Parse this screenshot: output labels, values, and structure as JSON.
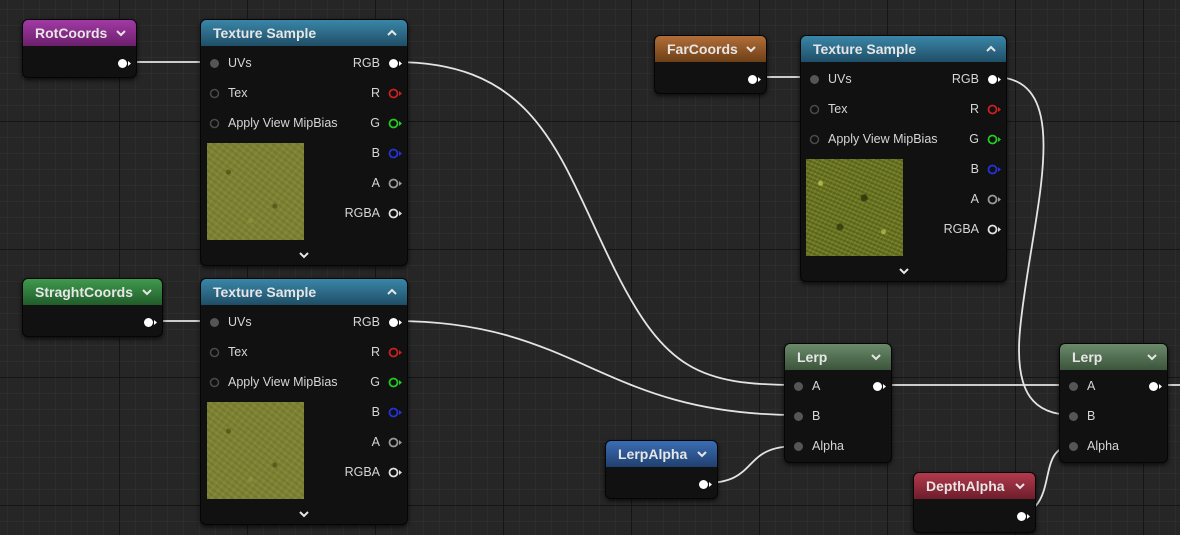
{
  "colors": {
    "background": "#262626",
    "wire": "#e4e4e4",
    "texture_header": "#3a86a8",
    "lerp_header": "#6a8a6a",
    "param_purple": "#a23aa4",
    "param_orange": "#b26e38",
    "param_green": "#3f9a4d",
    "param_blue": "#3b6db4",
    "param_red": "#b23a4e",
    "pin_r": "#cc1f1f",
    "pin_g": "#1fcc1f",
    "pin_b": "#2233dd"
  },
  "icons": {
    "collapse": "chevron-down-icon",
    "expand_node": "chevron-up-icon",
    "more_pins": "chevron-down-icon",
    "pin_connected": "filled-circle-pin-icon",
    "pin_unconnected": "hollow-circle-pin-icon"
  },
  "nodes": {
    "rot_coords": {
      "title": "RotCoords"
    },
    "straight_coords": {
      "title": "StraghtCoords"
    },
    "far_coords": {
      "title": "FarCoords"
    },
    "lerp_alpha": {
      "title": "LerpAlpha"
    },
    "depth_alpha": {
      "title": "DepthAlpha"
    },
    "texture_sample_1": {
      "title": "Texture Sample",
      "inputs": [
        "UVs",
        "Tex",
        "Apply View MipBias"
      ],
      "outputs": [
        "RGB",
        "R",
        "G",
        "B",
        "A",
        "RGBA"
      ]
    },
    "texture_sample_2": {
      "title": "Texture Sample",
      "inputs": [
        "UVs",
        "Tex",
        "Apply View MipBias"
      ],
      "outputs": [
        "RGB",
        "R",
        "G",
        "B",
        "A",
        "RGBA"
      ]
    },
    "texture_sample_3": {
      "title": "Texture Sample",
      "inputs": [
        "UVs",
        "Tex",
        "Apply View MipBias"
      ],
      "outputs": [
        "RGB",
        "R",
        "G",
        "B",
        "A",
        "RGBA"
      ]
    },
    "lerp_1": {
      "title": "Lerp",
      "inputs": [
        "A",
        "B",
        "Alpha"
      ]
    },
    "lerp_2": {
      "title": "Lerp",
      "inputs": [
        "A",
        "B",
        "Alpha"
      ]
    }
  }
}
